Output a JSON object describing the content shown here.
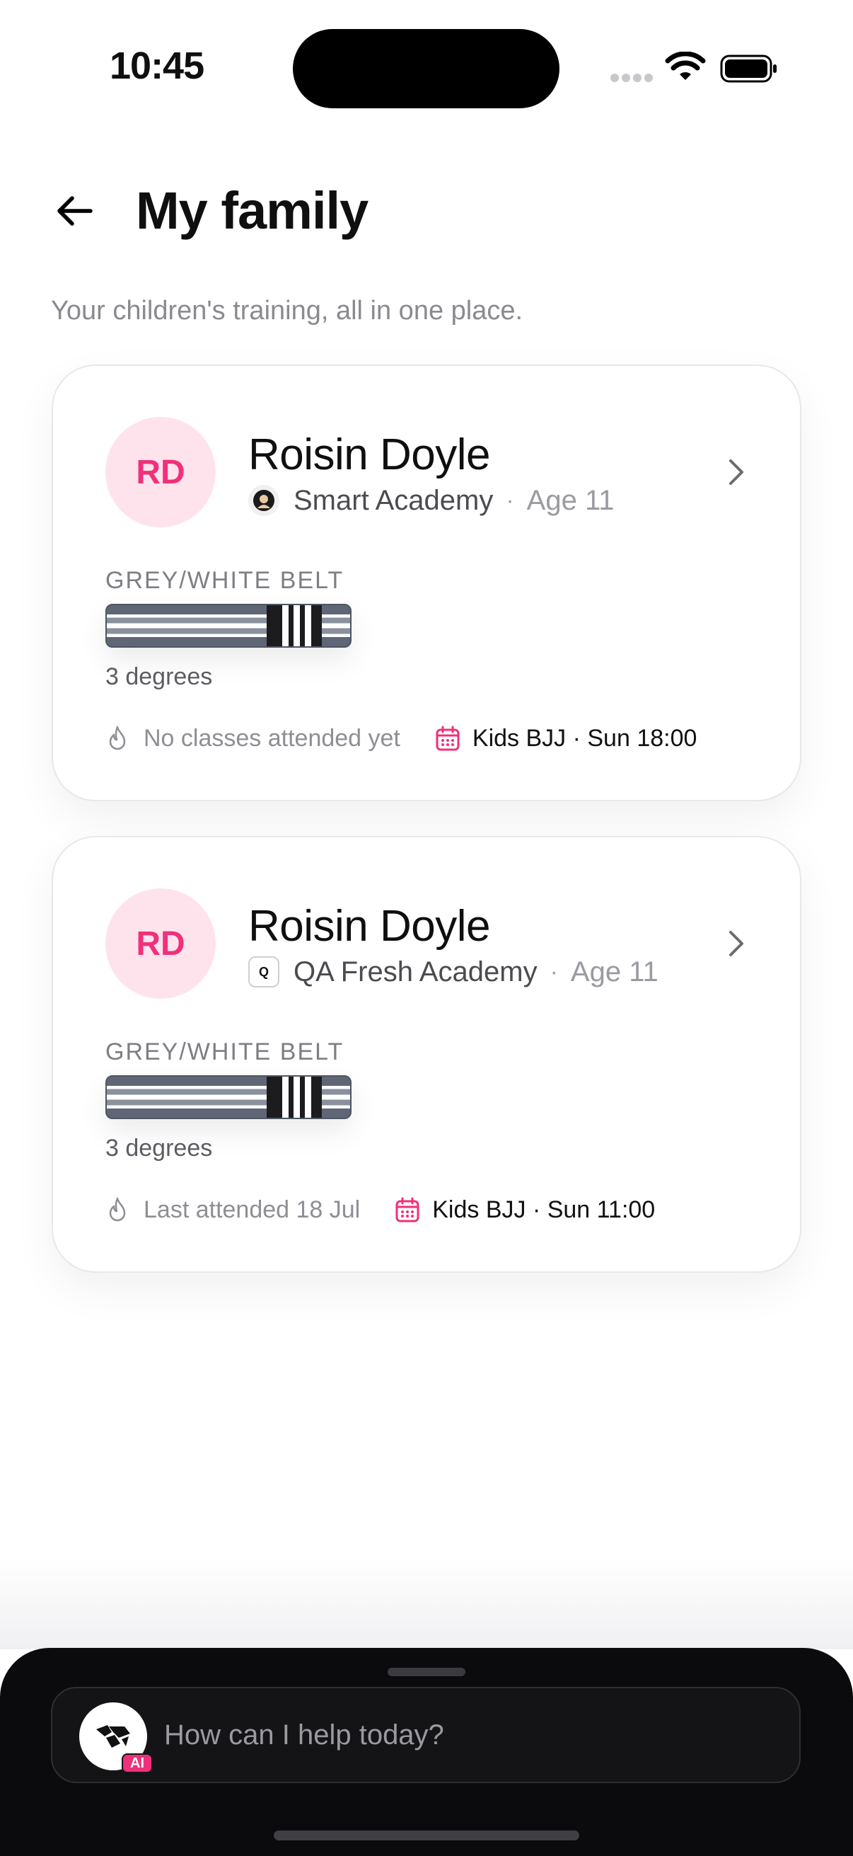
{
  "status_bar": {
    "time": "10:45"
  },
  "header": {
    "title": "My family",
    "subtitle": "Your children's training, all in one place."
  },
  "children": [
    {
      "initials": "RD",
      "name": "Roisin Doyle",
      "gym": "Smart Academy",
      "age": "Age 11",
      "belt_title": "GREY/WHITE BELT",
      "degrees": "3 degrees",
      "degree_count": 3,
      "attendance": "No classes attended yet",
      "next_class": "Kids BJJ · Sun 18:00"
    },
    {
      "initials": "RD",
      "name": "Roisin Doyle",
      "gym": "QA Fresh Academy",
      "gym_logo_letter": "Q",
      "age": "Age 11",
      "belt_title": "GREY/WHITE BELT",
      "degrees": "3 degrees",
      "degree_count": 3,
      "attendance": "Last attended 18 Jul",
      "next_class": "Kids BJJ · Sun 11:00"
    }
  ],
  "separator": "·",
  "assistant": {
    "placeholder": "How can I help today?",
    "badge": "AI"
  },
  "colors": {
    "accent": "#f0307a",
    "avatar_bg": "#ffe3ec",
    "sheet_bg": "#0b0b0d"
  }
}
